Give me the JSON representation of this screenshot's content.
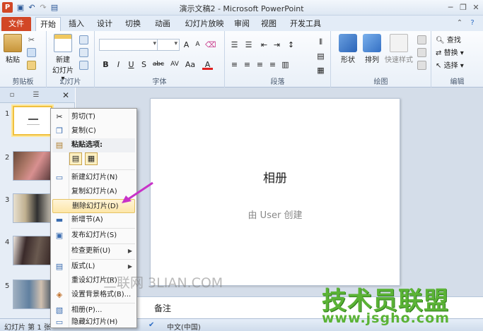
{
  "titlebar": {
    "app_icon": "P",
    "title": "演示文稿2 - Microsoft PowerPoint",
    "icons": [
      "save-icon",
      "undo-icon",
      "redo-icon",
      "quick-access-icon"
    ],
    "minimize": "─",
    "restore": "❐",
    "close": "✕"
  },
  "tabs": [
    {
      "label": "文件"
    },
    {
      "label": "开始"
    },
    {
      "label": "插入"
    },
    {
      "label": "设计"
    },
    {
      "label": "切换"
    },
    {
      "label": "动画"
    },
    {
      "label": "幻灯片放映"
    },
    {
      "label": "审阅"
    },
    {
      "label": "视图"
    },
    {
      "label": "开发工具"
    }
  ],
  "ribbon": {
    "groups": {
      "clipboard": "剪贴板",
      "slides": "幻灯片",
      "font": "字体",
      "paragraph": "段落",
      "drawing": "绘图",
      "editing": "编辑"
    },
    "paste_label": "粘贴",
    "new_slide_label": "新建",
    "new_slide_label2": "幻灯片 ▾",
    "shapes_label": "形状",
    "arrange_label": "排列",
    "quick_styles_label": "快速样式",
    "find_label": "查找",
    "replace_label": "替换 ▾",
    "select_label": "选择 ▾",
    "font_buttons": [
      "B",
      "I",
      "U",
      "S",
      "abc",
      "AV",
      "Aa",
      "A"
    ]
  },
  "panel": {
    "slides": [
      {
        "num": "1"
      },
      {
        "num": "2"
      },
      {
        "num": "3"
      },
      {
        "num": "4"
      },
      {
        "num": "5"
      }
    ]
  },
  "slide": {
    "title": "相册",
    "subtitle": "由 User 创建"
  },
  "notes": {
    "label": "备注"
  },
  "status": {
    "slide_info": "幻灯片 第 1 张",
    "language": "中文(中国)"
  },
  "context_menu": {
    "items": [
      {
        "label": "剪切(T)",
        "icon": "scissors-icon"
      },
      {
        "label": "复制(C)",
        "icon": "copy-icon"
      },
      {
        "label": "粘贴选项:",
        "icon": "paste-icon"
      },
      {
        "label": "新建幻灯片(N)",
        "icon": "new-slide-icon"
      },
      {
        "label": "复制幻灯片(A)",
        "icon": "duplicate-slide-icon"
      },
      {
        "label": "删除幻灯片(D)",
        "icon": "delete-slide-icon"
      },
      {
        "label": "新增节(A)",
        "icon": "new-section-icon"
      },
      {
        "label": "发布幻灯片(S)",
        "icon": "publish-icon"
      },
      {
        "label": "检查更新(U)",
        "icon": "check-update-icon"
      },
      {
        "label": "版式(L)",
        "icon": "layout-icon"
      },
      {
        "label": "重设幻灯片(R)",
        "icon": "reset-icon"
      },
      {
        "label": "设置背景格式(B)...",
        "icon": "background-icon"
      },
      {
        "label": "相册(P)...",
        "icon": "album-icon"
      },
      {
        "label": "隐藏幻灯片(H)",
        "icon": "hide-icon"
      }
    ]
  },
  "watermarks": {
    "site1": "三联网 3LIAN.COM",
    "brand": "技术员联盟",
    "url": "www.jsgho.com"
  },
  "colors": {
    "accent": "#d24726",
    "highlight": "#fde6a8",
    "annotation_arrow": "#c832c8",
    "brand_green": "#5bb336"
  }
}
